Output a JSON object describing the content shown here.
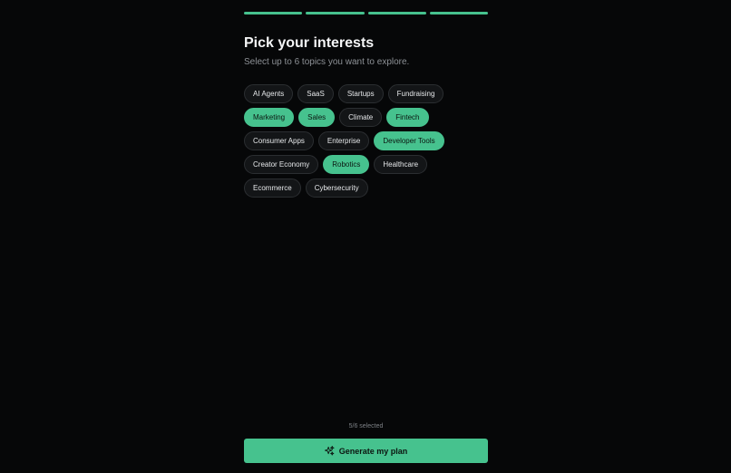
{
  "progress": {
    "steps": [
      "complete",
      "complete",
      "complete",
      "complete"
    ],
    "color_active": "#46c28e"
  },
  "header": {
    "title": "Pick your interests",
    "subtitle": "Select up to 6 topics you want to explore."
  },
  "topics": [
    {
      "label": "AI Agents",
      "selected": false
    },
    {
      "label": "SaaS",
      "selected": false
    },
    {
      "label": "Startups",
      "selected": false
    },
    {
      "label": "Fundraising",
      "selected": false
    },
    {
      "label": "Marketing",
      "selected": true
    },
    {
      "label": "Sales",
      "selected": true
    },
    {
      "label": "Climate",
      "selected": false
    },
    {
      "label": "Fintech",
      "selected": true
    },
    {
      "label": "Consumer Apps",
      "selected": false
    },
    {
      "label": "Enterprise",
      "selected": false
    },
    {
      "label": "Developer Tools",
      "selected": true
    },
    {
      "label": "Creator Economy",
      "selected": false
    },
    {
      "label": "Robotics",
      "selected": true
    },
    {
      "label": "Healthcare",
      "selected": false
    },
    {
      "label": "Ecommerce",
      "selected": false
    },
    {
      "label": "Cybersecurity",
      "selected": false
    }
  ],
  "footer": {
    "selected_count": "5/6 selected",
    "cta_label": "Generate my plan",
    "cta_icon": "sparkles-icon"
  },
  "colors": {
    "background": "#060708",
    "accent": "#46c28e",
    "chip_bg": "#131517",
    "chip_border": "#2b2e31"
  }
}
